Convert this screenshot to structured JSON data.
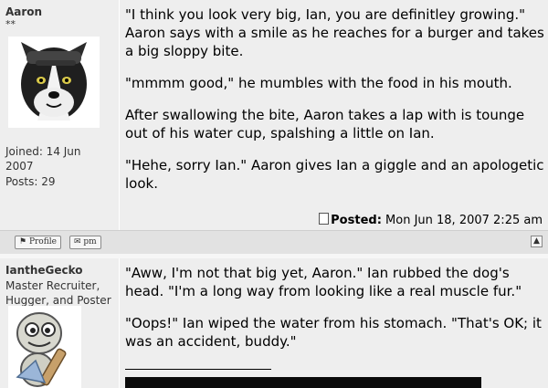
{
  "post1": {
    "username": "Aaron",
    "stars": "**",
    "joined": "Joined: 14 Jun 2007",
    "posts": "Posts: 29",
    "paragraphs": [
      "\"I think you look very big, Ian, you are definitley growing.\" Aaron says with a smile as he reaches for a burger and takes a big sloppy bite.",
      "\"mmmm good,\" he mumbles with the food in his mouth.",
      "After swallowing the bite, Aaron takes a lap with is tounge out of his water cup, spalshing a little on Ian.",
      "\"Hehe, sorry Ian.\" Aaron gives Ian a giggle and an apologetic look."
    ],
    "posted_label": "Posted:",
    "posted_date": "Mon Jun 18, 2007 2:25 am"
  },
  "buttons": {
    "profile": "Profile",
    "pm": "pm"
  },
  "post2": {
    "username": "IantheGecko",
    "rank": "Master Recruiter, Hugger, and Poster",
    "paragraphs": [
      "\"Aww, I'm not that big yet, Aaron.\" Ian rubbed the dog's head. \"I'm a long way from looking like a real muscle fur.\"",
      "\"Oops!\" Ian wiped the water from his stomach. \"That's OK; it was an accident, buddy.\""
    ]
  }
}
